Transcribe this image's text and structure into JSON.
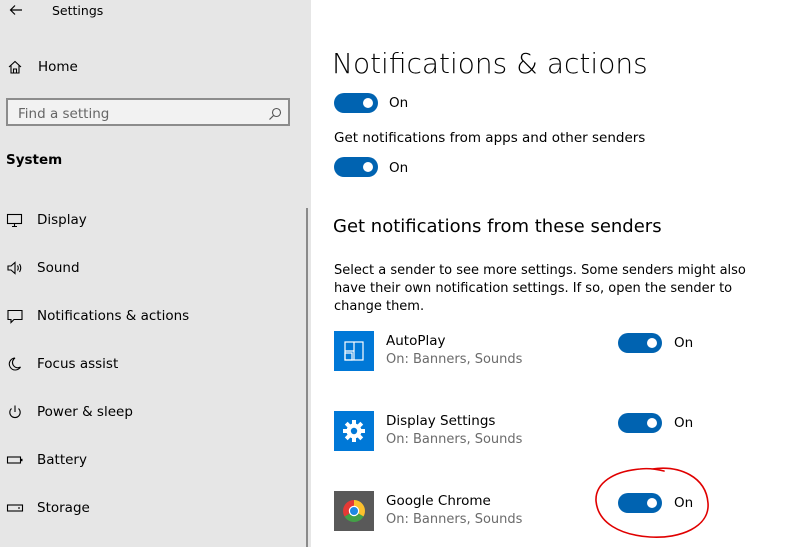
{
  "app": {
    "title": "Settings"
  },
  "sidebar": {
    "home_label": "Home",
    "search_placeholder": "Find a setting",
    "section_heading": "System",
    "items": [
      {
        "label": "Display",
        "icon": "monitor-icon"
      },
      {
        "label": "Sound",
        "icon": "speaker-icon"
      },
      {
        "label": "Notifications & actions",
        "icon": "notification-icon"
      },
      {
        "label": "Focus assist",
        "icon": "moon-icon"
      },
      {
        "label": "Power & sleep",
        "icon": "power-icon"
      },
      {
        "label": "Battery",
        "icon": "battery-icon"
      },
      {
        "label": "Storage",
        "icon": "storage-icon"
      }
    ]
  },
  "main": {
    "title": "Notifications & actions",
    "top_toggle": {
      "state": "On",
      "on": true
    },
    "get_notifications_label": "Get notifications from apps and other senders",
    "get_notifications_toggle": {
      "state": "On",
      "on": true
    },
    "senders_heading": "Get notifications from these senders",
    "senders_description": "Select a sender to see more settings. Some senders might also have their own notification settings. If so, open the sender to change them.",
    "senders": [
      {
        "name": "AutoPlay",
        "detail": "On: Banners, Sounds",
        "state": "On",
        "icon": "autoplay-icon"
      },
      {
        "name": "Display Settings",
        "detail": "On: Banners, Sounds",
        "state": "On",
        "icon": "gear-icon"
      },
      {
        "name": "Google Chrome",
        "detail": "On: Banners, Sounds",
        "state": "On",
        "icon": "chrome-icon"
      }
    ]
  },
  "colors": {
    "accent": "#0063b1",
    "sidebar_bg": "#e6e6e6",
    "annotation": "#e00000"
  }
}
